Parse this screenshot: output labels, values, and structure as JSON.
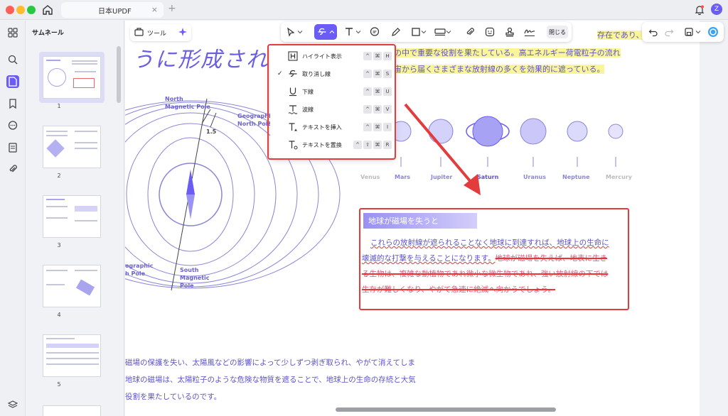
{
  "window": {
    "tab_title": "日本UPDF",
    "tab_close": "×",
    "tab_add": "+",
    "avatar_letter": "Z"
  },
  "sidebar": {
    "title": "サムネール",
    "pages": [
      "1",
      "2",
      "3",
      "4",
      "5"
    ]
  },
  "toolbar": {
    "tool_label": "ツール",
    "close_label": "閉じる"
  },
  "menu": {
    "items": [
      {
        "label": "ハイライト表示",
        "checked": false,
        "keys": [
          "^",
          "⌘",
          "H"
        ]
      },
      {
        "label": "取り消し線",
        "checked": true,
        "keys": [
          "^",
          "⌘",
          "S"
        ]
      },
      {
        "label": "下線",
        "checked": false,
        "keys": [
          "^",
          "⌘",
          "U"
        ]
      },
      {
        "label": "波線",
        "checked": false,
        "keys": [
          "^",
          "⌘",
          "V"
        ]
      },
      {
        "label": "テキストを挿入",
        "checked": false,
        "keys": [
          "^",
          "⌘",
          "I"
        ]
      },
      {
        "label": "テキストを置換",
        "checked": false,
        "keys": [
          "^",
          "⇧",
          "⌘",
          "R"
        ]
      }
    ],
    "check_mark": "✓"
  },
  "document": {
    "title_fragment": "うに形成され",
    "top_lines": [
      "存在であり、",
      "の中で重要な役割を果たしている。高エネルギー荷電粒子の流れ",
      "宙から届くさまざまな放射線の多くを効果的に遮っている。"
    ],
    "diagram": {
      "north_magnetic": [
        "North",
        "Magnetic Pole"
      ],
      "geographic_north": [
        "Geographic",
        "North Pole"
      ],
      "angle": "1.5",
      "south_magnetic": [
        "South",
        "Magnetic",
        "Pole"
      ],
      "geographic_south": [
        "ographic",
        "h Pole"
      ]
    },
    "planets": [
      "Venus",
      "Mars",
      "Jupiter",
      "Saturn",
      "Uranus",
      "Neptune",
      "Mercury"
    ],
    "callout": {
      "heading": "地球が磁場を失うと",
      "line1_wavy": "これらの放射線が遮られることなく地球に到達すれば、地球上の生命に",
      "line2_wavy": "壊滅的な打撃を与えることになります。",
      "line2_strike": "地球が磁場を失えば、地表に生き",
      "line3_strike": "る生物は、複雑な動植物であれ微小な微生物であれ、強い放射線の下では",
      "line4_strike": "生存が難しくなり、やがて急速に絶滅へ向かうでしょう。"
    },
    "bottom_lines": [
      "磁場の保護を失い、太陽風などの影響によって少しずつ剥ぎ取られ、やがて消えてしま",
      "地球の磁場は、太陽粒子のような危険な物質を遮ることで、地球上の生命の存続と大気",
      "役割を果たしているのです。"
    ]
  },
  "colors": {
    "accent": "#6c5cf6",
    "annotation_red": "#e23c3c",
    "highlight": "#fbf59a",
    "doc_text": "#5b53c8"
  }
}
